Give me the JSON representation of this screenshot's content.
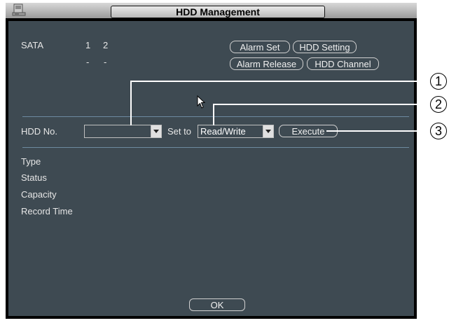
{
  "window": {
    "title": "HDD Management",
    "icon": "hdd-icon"
  },
  "sata": {
    "label": "SATA",
    "ports": [
      "1",
      "2"
    ],
    "states": [
      "-",
      "-"
    ]
  },
  "buttons": {
    "alarm_set": "Alarm Set",
    "hdd_setting": "HDD Setting",
    "alarm_release": "Alarm Release",
    "hdd_channel": "HDD Channel",
    "execute": "Execute",
    "ok": "OK"
  },
  "hdd_row": {
    "hdd_no_label": "HDD No.",
    "hdd_no_value": "",
    "set_to_label": "Set to",
    "set_to_value": "Read/Write"
  },
  "info_labels": [
    "Type",
    "Status",
    "Capacity",
    "Record Time"
  ],
  "callouts": [
    "1",
    "2",
    "3"
  ],
  "colors": {
    "panel": "#3e4a52",
    "text": "#e6e6e6",
    "separator": "#6d8aa0"
  }
}
